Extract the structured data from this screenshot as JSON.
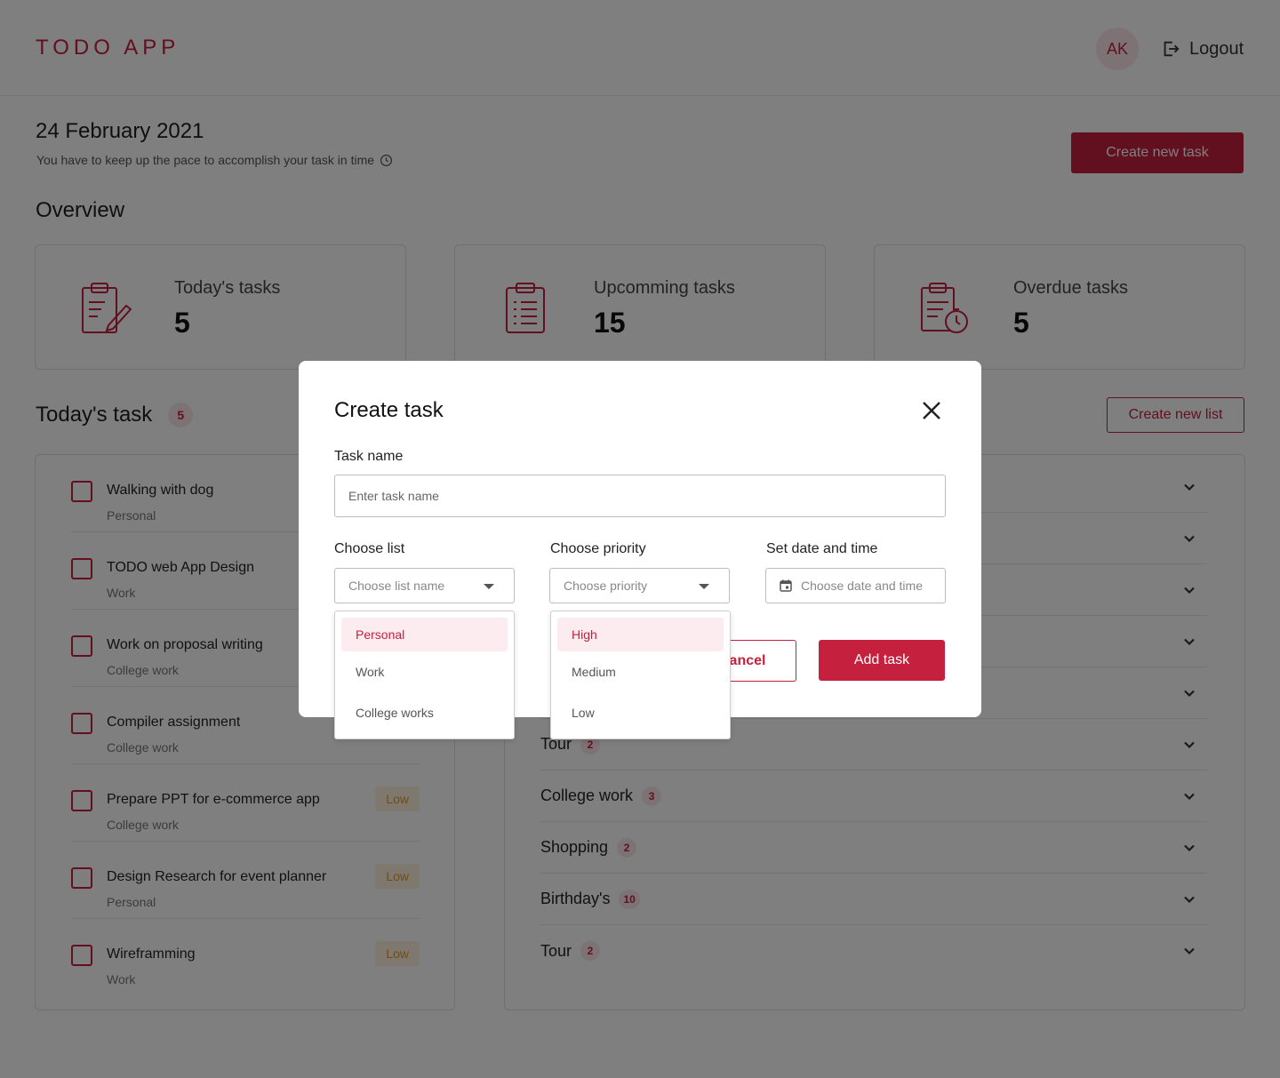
{
  "app": {
    "logo": "TODO APP"
  },
  "header": {
    "avatar_initials": "AK",
    "logout_label": "Logout"
  },
  "intro": {
    "date": "24 February 2021",
    "subtitle": "You have to keep up the pace to accomplish your task in time",
    "create_task_label": "Create new task",
    "overview_title": "Overview"
  },
  "overview": [
    {
      "label": "Today's tasks",
      "value": "5",
      "icon": "clipboard-pencil-icon"
    },
    {
      "label": "Upcomming tasks",
      "value": "15",
      "icon": "clipboard-list-icon"
    },
    {
      "label": "Overdue tasks",
      "value": "5",
      "icon": "clipboard-timer-icon"
    }
  ],
  "todays_task": {
    "title": "Today's task",
    "count": "5",
    "create_list_label": "Create new list",
    "items": [
      {
        "name": "Walking with dog",
        "list": "Personal",
        "priority": ""
      },
      {
        "name": "TODO web App Design",
        "list": "Work",
        "priority": ""
      },
      {
        "name": "Work on proposal writing",
        "list": "College work",
        "priority": ""
      },
      {
        "name": "Compiler assignment",
        "list": "College work",
        "priority": ""
      },
      {
        "name": "Prepare PPT for e-commerce app",
        "list": "College work",
        "priority": "Low"
      },
      {
        "name": "Design Research for event planner",
        "list": "Personal",
        "priority": "Low"
      },
      {
        "name": "Wireframming",
        "list": "Work",
        "priority": "Low"
      }
    ]
  },
  "lists": [
    {
      "name": "",
      "count": ""
    },
    {
      "name": "",
      "count": ""
    },
    {
      "name": "",
      "count": ""
    },
    {
      "name": "",
      "count": ""
    },
    {
      "name": "",
      "count": ""
    },
    {
      "name": "Tour",
      "count": "2"
    },
    {
      "name": "College work",
      "count": "3"
    },
    {
      "name": "Shopping",
      "count": "2"
    },
    {
      "name": "Birthday's",
      "count": "10"
    },
    {
      "name": "Tour",
      "count": "2"
    }
  ],
  "modal": {
    "title": "Create task",
    "task_name_label": "Task name",
    "task_name_placeholder": "Enter task name",
    "choose_list_label": "Choose list",
    "choose_list_placeholder": "Choose list name",
    "choose_priority_label": "Choose priority",
    "choose_priority_placeholder": "Choose priority",
    "date_label": "Set date and time",
    "date_placeholder": "Choose date and time",
    "cancel_label": "Cancel",
    "add_label": "Add task"
  },
  "list_options": [
    "Personal",
    "Work",
    "College works"
  ],
  "priority_options": [
    "High",
    "Medium",
    "Low"
  ],
  "colors": {
    "accent": "#c5203e",
    "accent_light": "#fbe4e8",
    "low_priority": "#e2992e"
  }
}
